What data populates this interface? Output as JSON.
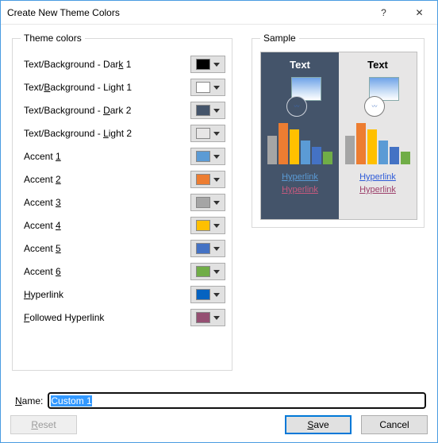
{
  "window": {
    "title": "Create New Theme Colors",
    "help_glyph": "?",
    "close_glyph": "✕"
  },
  "groups": {
    "theme_colors_legend": "Theme colors",
    "sample_legend": "Sample"
  },
  "rows": [
    {
      "pre": "Text/Background - Dar",
      "akey": "k",
      "post": " 1",
      "color": "#000000"
    },
    {
      "pre": "Text/",
      "akey": "B",
      "post": "ackground - Light 1",
      "color": "#ffffff"
    },
    {
      "pre": "Text/Background - ",
      "akey": "D",
      "post": "ark 2",
      "color": "#44546a"
    },
    {
      "pre": "Text/Background - ",
      "akey": "L",
      "post": "ight 2",
      "color": "#e7e6e6"
    },
    {
      "pre": "Accent ",
      "akey": "1",
      "post": "",
      "color": "#5b9bd5"
    },
    {
      "pre": "Accent ",
      "akey": "2",
      "post": "",
      "color": "#ed7d31"
    },
    {
      "pre": "Accent ",
      "akey": "3",
      "post": "",
      "color": "#a5a5a5"
    },
    {
      "pre": "Accent ",
      "akey": "4",
      "post": "",
      "color": "#ffc000"
    },
    {
      "pre": "Accent ",
      "akey": "5",
      "post": "",
      "color": "#4472c4"
    },
    {
      "pre": "Accent ",
      "akey": "6",
      "post": "",
      "color": "#70ad47"
    },
    {
      "pre": "",
      "akey": "H",
      "post": "yperlink",
      "color": "#0563c1"
    },
    {
      "pre": "",
      "akey": "F",
      "post": "ollowed Hyperlink",
      "color": "#954f72"
    }
  ],
  "sample": {
    "text_label": "Text",
    "hyperlink_label": "Hyperlink",
    "bars": [
      {
        "h": 36,
        "c": "#a5a5a5"
      },
      {
        "h": 52,
        "c": "#ed7d31"
      },
      {
        "h": 44,
        "c": "#ffc000"
      },
      {
        "h": 30,
        "c": "#5b9bd5"
      },
      {
        "h": 22,
        "c": "#4472c4"
      },
      {
        "h": 16,
        "c": "#70ad47"
      }
    ]
  },
  "name": {
    "label_pre": "",
    "label_akey": "N",
    "label_post": "ame:",
    "value": "Custom 1"
  },
  "buttons": {
    "reset_pre": "",
    "reset_akey": "R",
    "reset_post": "eset",
    "save_pre": "",
    "save_akey": "S",
    "save_post": "ave",
    "cancel": "Cancel"
  }
}
